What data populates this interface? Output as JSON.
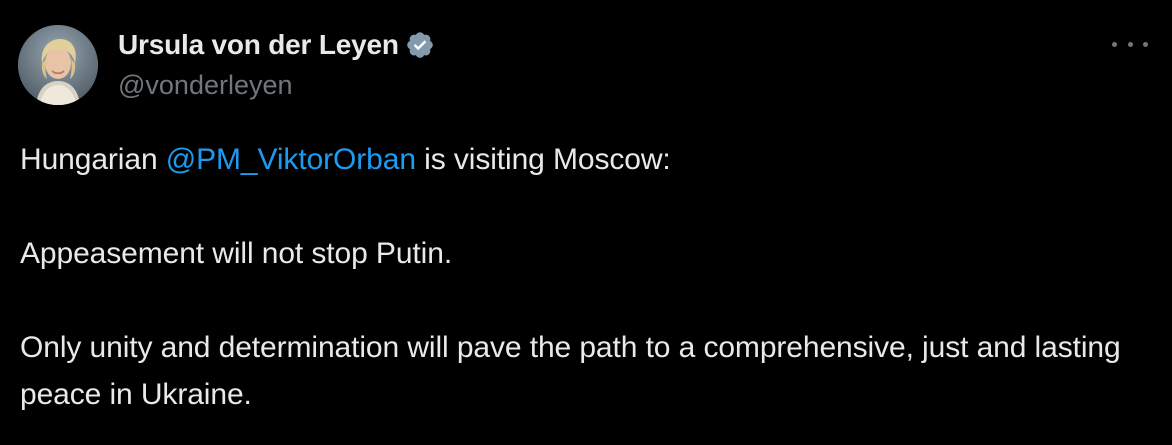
{
  "author": {
    "display_name": "Ursula von der Leyen",
    "handle": "@vonderleyen",
    "verified_icon": "verified-badge-icon",
    "avatar_icon": "profile-photo",
    "badge_color": "#829aab"
  },
  "menu": {
    "icon": "more-options-icon"
  },
  "tweet": {
    "line1_prefix": "Hungarian ",
    "mention": "@PM_ViktorOrban",
    "line1_suffix": " is visiting Moscow:",
    "line2": "Appeasement will not stop Putin.",
    "line3": "Only unity and determination will pave the path to a comprehensive, just and lasting peace in Ukraine."
  },
  "colors": {
    "background": "#000000",
    "text": "#e7e9ea",
    "secondary_text": "#71767b",
    "link": "#1d9bf0"
  }
}
